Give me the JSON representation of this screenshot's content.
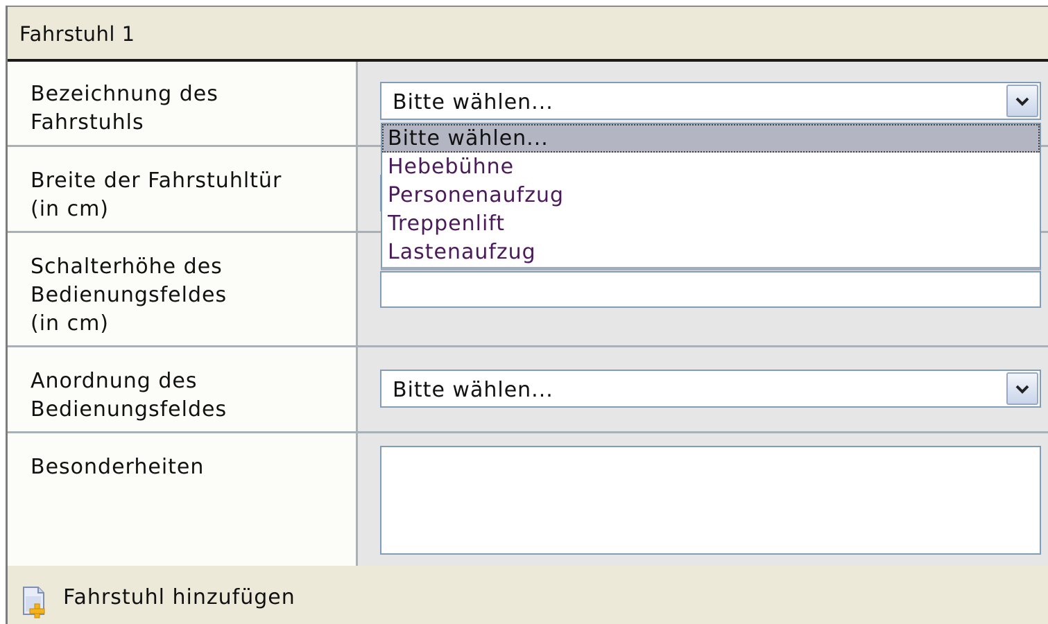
{
  "section": {
    "title": "Fahrstuhl 1"
  },
  "fields": {
    "bezeichnung": {
      "label_line1": "Bezeichnung des",
      "label_line2": "Fahrstuhls",
      "selected": "Bitte wählen...",
      "options": [
        "Bitte wählen...",
        "Hebebühne",
        "Personenaufzug",
        "Treppenlift",
        "Lastenaufzug"
      ]
    },
    "breite": {
      "label_line1": "Breite der Fahrstuhltür",
      "label_line2": "(in cm)",
      "value": ""
    },
    "schalterhoehe": {
      "label_line1": "Schalterhöhe des",
      "label_line2": "Bedienungsfeldes",
      "label_line3": "(in cm)",
      "value": ""
    },
    "anordnung": {
      "label_line1": "Anordnung des",
      "label_line2": "Bedienungsfeldes",
      "selected": "Bitte wählen..."
    },
    "besonderheiten": {
      "label": "Besonderheiten",
      "value": ""
    }
  },
  "footer": {
    "add_label": "Fahrstuhl hinzufügen",
    "add_icon": "add-document-icon"
  },
  "icons": {
    "dropdown_arrow": "chevron-down-icon"
  },
  "colors": {
    "header_bg": "#ece9d8",
    "label_bg": "#fcfcf8",
    "input_cell_bg": "#e6e6e6",
    "input_border": "#7f9db9",
    "selected_option_bg": "#b3b6c2",
    "option_text": "#4a1a5a"
  }
}
